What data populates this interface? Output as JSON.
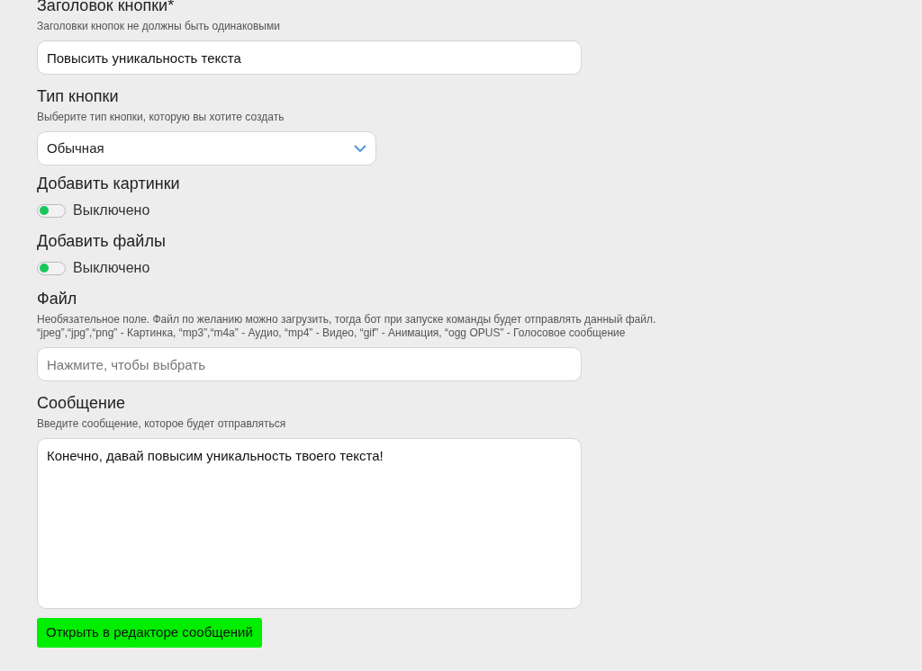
{
  "fields": [
    {
      "kind": "text",
      "label": "Заголовок кнопки*",
      "hint": "Заголовки кнопок не должны быть одинаковыми",
      "value": "Повысить уникальность текста"
    },
    {
      "kind": "select",
      "label": "Тип кнопки",
      "hint": "Выберите тип кнопки, которую вы хотите создать",
      "value": "Обычная"
    },
    {
      "kind": "toggle",
      "label": "Добавить картинки",
      "on": false,
      "state_text": "Выключено"
    },
    {
      "kind": "toggle",
      "label": "Добавить файлы",
      "on": false,
      "state_text": "Выключено"
    },
    {
      "kind": "file",
      "label": "Файл",
      "hint": "Необязательное поле. Файл по желанию можно загрузить, тогда бот при запуске команды будет отправлять данный файл. “jpeg”,“jpg”,“png” - Картинка, “mp3”,“m4a” - Аудио, “mp4” - Видео, “gif” - Анимация, “ogg OPUS” - Голосовое сообщение",
      "placeholder": "Нажмите, чтобы выбрать"
    },
    {
      "kind": "textarea",
      "label": "Сообщение",
      "hint": "Введите сообщение, которое будет отправляться",
      "value": "Конечно, давай повысим уникальность твоего текста!"
    }
  ],
  "editor_button": "Открыть в редакторе сообщений"
}
